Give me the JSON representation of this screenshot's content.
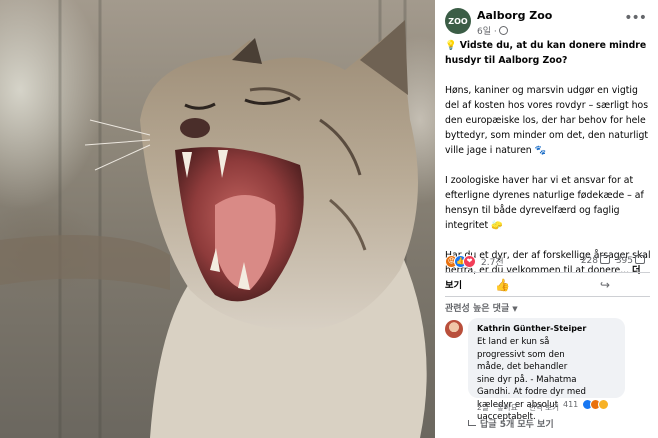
{
  "photo": {
    "description_icon": "lynx-yawning-photo"
  },
  "post": {
    "page_name": "Aalborg Zoo",
    "avatar_text": "ZOO",
    "time": "6일 ·",
    "title": "💡 Vidste du, at du kan donere mindre husdyr til Aalborg Zoo?",
    "paragraph1": "Høns, kaniner og marsvin udgør en vigtig del af kosten hos vores rovdyr – særligt hos den europæiske los, der har behov for hele byttedyr, som minder om det, den naturligt ville jage i naturen 🐾",
    "paragraph2": "I zoologiske haver har vi et ansvar for at efterligne dyrenes naturlige fødekæde – af hensyn til både dyrevelfærd og faglig integritet 🧽",
    "paragraph3": "Har du et dyr, der af forskellige årsager skal herfra, er du velkommen til at donere...",
    "see_more": "더 보기"
  },
  "stats": {
    "reactions": "2.7천",
    "comments": "228",
    "shares": "395"
  },
  "filter": {
    "label": "관련성 높은 댓글"
  },
  "comment": {
    "author": "Kathrin Günther-Steiper",
    "text": "Et land er kun så progressivt som den måde, det behandler sine dyr på. - Mahatma Gandhi. At fodre dyr med kæledyr er absolut uacceptabelt.",
    "time": "2일",
    "like": "좋아요",
    "translate": "번역 보기",
    "reactions": "411",
    "replies": "답글 5개 모두 보기"
  },
  "colors": {
    "like_blue": "#1877f2",
    "love_red": "#f33e58",
    "angry_orange": "#e9710f",
    "text_gray": "#65676b"
  }
}
